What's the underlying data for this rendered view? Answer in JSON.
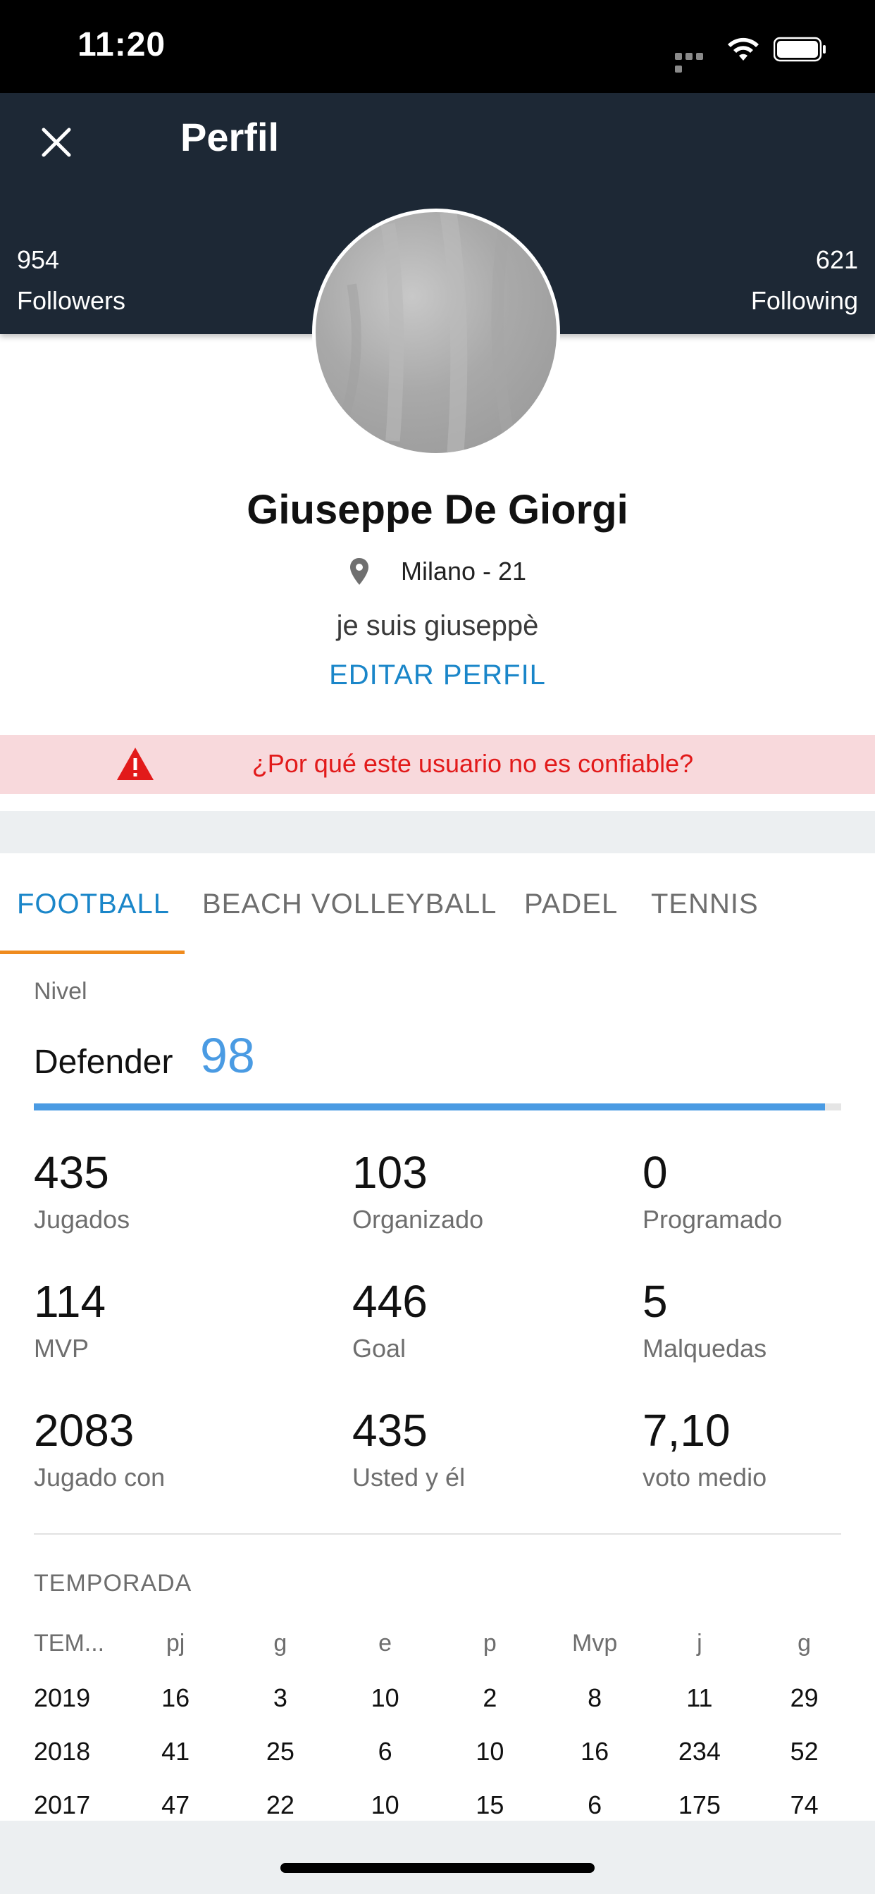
{
  "status_bar": {
    "time": "11:20"
  },
  "header": {
    "title": "Perfil",
    "followers": {
      "count": "954",
      "label": "Followers"
    },
    "following": {
      "count": "621",
      "label": "Following"
    }
  },
  "profile": {
    "name": "Giuseppe De Giorgi",
    "location": "Milano - 21",
    "bio": "je suis giuseppè",
    "edit_label": "EDITAR PERFIL"
  },
  "warning": {
    "text": "¿Por qué este usuario no es confiable?"
  },
  "tabs": [
    {
      "label": "FOOTBALL",
      "active": true
    },
    {
      "label": "BEACH VOLLEYBALL",
      "active": false
    },
    {
      "label": "PADEL",
      "active": false
    },
    {
      "label": "TENNIS",
      "active": false
    }
  ],
  "level": {
    "label": "Nivel",
    "role": "Defender",
    "value": "98",
    "progress": 0.98
  },
  "stats": [
    {
      "value": "435",
      "label": "Jugados"
    },
    {
      "value": "103",
      "label": "Organizado"
    },
    {
      "value": "0",
      "label": "Programado"
    },
    {
      "value": "114",
      "label": "MVP"
    },
    {
      "value": "446",
      "label": "Goal"
    },
    {
      "value": "5",
      "label": "Malquedas"
    },
    {
      "value": "2083",
      "label": "Jugado con"
    },
    {
      "value": "435",
      "label": "Usted y él"
    },
    {
      "value": "7,10",
      "label": "voto medio"
    }
  ],
  "season": {
    "title": "TEMPORADA",
    "headers": [
      "TEM...",
      "pj",
      "g",
      "e",
      "p",
      "Mvp",
      "j",
      "g"
    ],
    "rows": [
      [
        "2019",
        "16",
        "3",
        "10",
        "2",
        "8",
        "11",
        "29"
      ],
      [
        "2018",
        "41",
        "25",
        "6",
        "10",
        "16",
        "234",
        "52"
      ],
      [
        "2017",
        "47",
        "22",
        "10",
        "15",
        "6",
        "175",
        "74"
      ]
    ]
  },
  "colors": {
    "header_bg": "#1d2835",
    "accent_blue": "#1a86c9",
    "level_blue": "#4a9be3",
    "tab_indicator": "#ef8b1e",
    "warning_bg": "#f8d9dc",
    "warning_text": "#e21a1a"
  },
  "icons": {
    "close": "close-icon",
    "location": "location-pin-icon",
    "warning": "warning-triangle-icon"
  }
}
